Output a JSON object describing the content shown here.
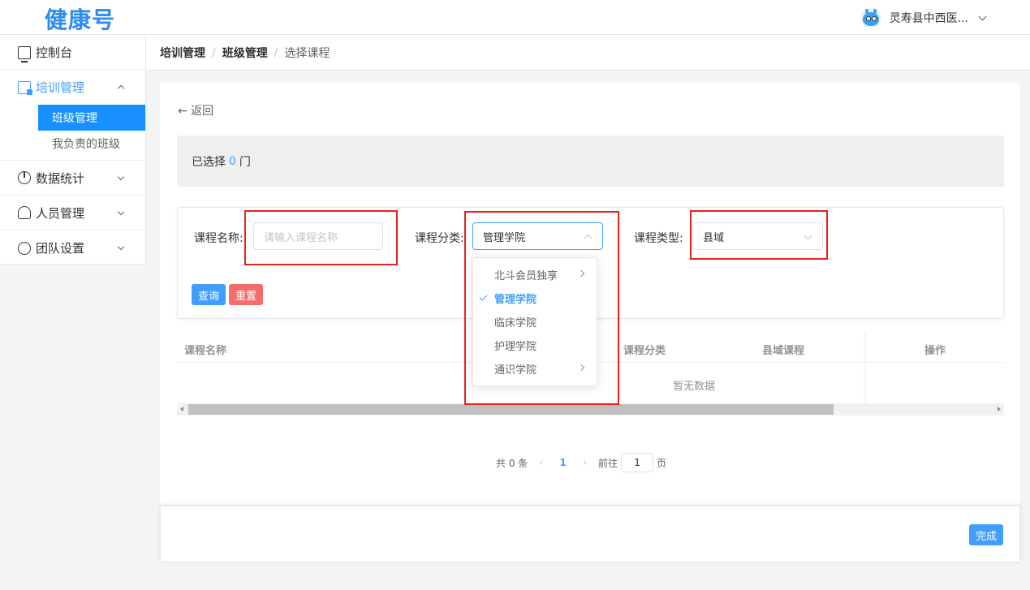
{
  "header": {
    "logo": "健康号",
    "user_name": "灵寿县中西医..."
  },
  "sidebar": {
    "items": [
      {
        "label": "控制台",
        "icon": "monitor-icon"
      },
      {
        "label": "培训管理",
        "icon": "training-icon",
        "expanded": true,
        "children": [
          {
            "label": "班级管理",
            "active": true
          },
          {
            "label": "我负责的班级"
          }
        ]
      },
      {
        "label": "数据统计",
        "icon": "chart-icon"
      },
      {
        "label": "人员管理",
        "icon": "users-icon"
      },
      {
        "label": "团队设置",
        "icon": "team-icon"
      }
    ]
  },
  "breadcrumb": {
    "level1": "培训管理",
    "level2": "班级管理",
    "current": "选择课程",
    "separator": "/"
  },
  "back_label": "← 返回",
  "selected": {
    "prefix": "已选择",
    "count": "0",
    "suffix": "门"
  },
  "search": {
    "name_label": "课程名称:",
    "name_placeholder": "请输入课程名称",
    "category_label": "课程分类:",
    "category_value": "管理学院",
    "type_label": "课程类型:",
    "type_value": "县域",
    "query_button": "查询",
    "reset_button": "重置"
  },
  "category_dropdown": {
    "options": [
      {
        "label": "北斗会员独享",
        "has_children": true
      },
      {
        "label": "管理学院",
        "selected": true
      },
      {
        "label": "临床学院"
      },
      {
        "label": "护理学院"
      },
      {
        "label": "通识学院",
        "has_children": true
      }
    ]
  },
  "table": {
    "columns": [
      "课程名称",
      "课程分类",
      "县域课程",
      "操作"
    ],
    "empty_text": "暂无数据"
  },
  "pagination": {
    "total": "共 0 条",
    "prev": "‹",
    "current_page": "1",
    "next": "›",
    "goto_prefix": "前往",
    "goto_value": "1",
    "goto_suffix": "页"
  },
  "footer": {
    "done_button": "完成"
  },
  "colors": {
    "primary": "#409eff",
    "danger": "#f56c6c",
    "highlight": "#e5231b"
  }
}
